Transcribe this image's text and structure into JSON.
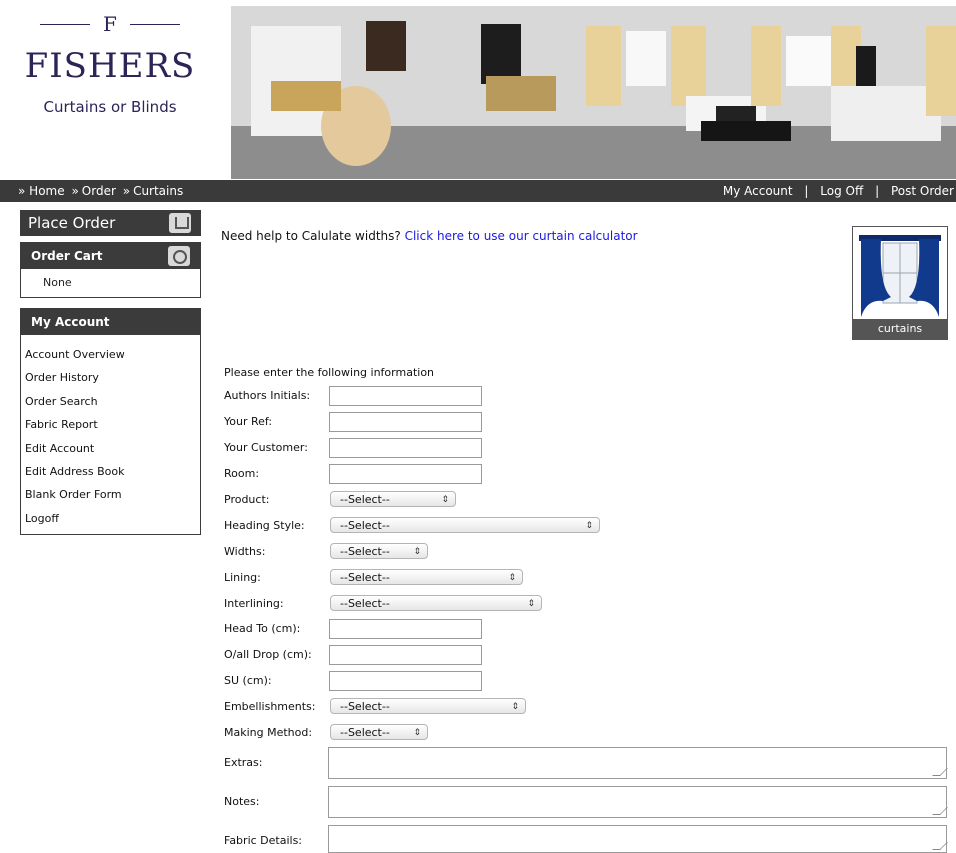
{
  "logo": {
    "letter": "F",
    "name": "FISHERS",
    "tagline": "Curtains or Blinds"
  },
  "breadcrumb": [
    {
      "prefix": "»",
      "label": "Home"
    },
    {
      "prefix": "»",
      "label": "Order"
    },
    {
      "prefix": "»",
      "label": "Curtains"
    }
  ],
  "account_links": {
    "my_account": "My Account",
    "log_off": "Log Off",
    "post_order": "Post Order",
    "separator": "|"
  },
  "sidebar": {
    "place_order": "Place Order",
    "cart_title": "Order Cart",
    "cart_content": "None",
    "account_title": "My Account",
    "account_items": [
      "Account Overview",
      "Order History",
      "Order Search",
      "Fabric Report",
      "Edit Account",
      "Edit Address Book",
      "Blank Order Form",
      "Logoff"
    ]
  },
  "help": {
    "text": "Need help to Calulate widths? ",
    "link": "Click here to use our curtain calculator"
  },
  "thumbnail": {
    "caption": "curtains"
  },
  "form": {
    "intro": "Please enter the following information",
    "authors_initials": {
      "label": "Authors Initials:",
      "value": ""
    },
    "your_ref": {
      "label": "Your Ref:",
      "value": ""
    },
    "your_customer": {
      "label": "Your Customer:",
      "value": ""
    },
    "room": {
      "label": "Room:",
      "value": ""
    },
    "product": {
      "label": "Product:",
      "selected": "--Select--"
    },
    "heading_style": {
      "label": "Heading Style:",
      "selected": "--Select--"
    },
    "widths": {
      "label": "Widths:",
      "selected": "--Select--"
    },
    "lining": {
      "label": "Lining:",
      "selected": "--Select--"
    },
    "interlining": {
      "label": "Interlining:",
      "selected": "--Select--"
    },
    "head_to": {
      "label": "Head To (cm):",
      "value": ""
    },
    "overall_drop": {
      "label": "O/all Drop (cm):",
      "value": ""
    },
    "su": {
      "label": "SU (cm):",
      "value": ""
    },
    "embellishments": {
      "label": "Embellishments:",
      "selected": "--Select--"
    },
    "making_method": {
      "label": "Making Method:",
      "selected": "--Select--"
    },
    "extras": {
      "label": "Extras:",
      "value": ""
    },
    "notes": {
      "label": "Notes:",
      "value": ""
    },
    "fabric_details": {
      "label": "Fabric Details:",
      "value": ""
    }
  },
  "colors": {
    "brand": "#2b2557",
    "bar": "#3a3a3a",
    "link": "#1a1ae0"
  },
  "icons": {
    "place_order": "order-form-icon",
    "cart": "cart-magnifier-icon"
  }
}
